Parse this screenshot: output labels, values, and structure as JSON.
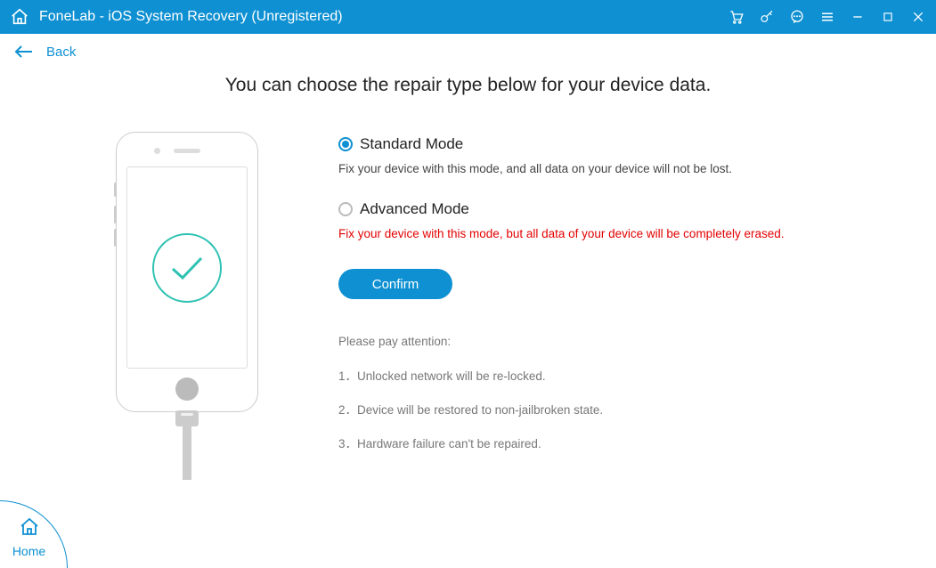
{
  "titlebar": {
    "title": "FoneLab - iOS System Recovery (Unregistered)"
  },
  "back": {
    "label": "Back"
  },
  "heading": "You can choose the repair type below for your device data.",
  "modes": {
    "standard": {
      "title": "Standard Mode",
      "desc": "Fix your device with this mode, and all data on your device will not be lost."
    },
    "advanced": {
      "title": "Advanced Mode",
      "desc": "Fix your device with this mode, but all data of your device will be completely erased."
    }
  },
  "buttons": {
    "confirm": "Confirm"
  },
  "attention": {
    "title": "Please pay attention:",
    "items": [
      "1．Unlocked network will be re-locked.",
      "2．Device will be restored to non-jailbroken state.",
      "3．Hardware failure can't be repaired."
    ]
  },
  "home": {
    "label": "Home"
  },
  "colors": {
    "primary": "#0e90d2",
    "teal": "#2ec2b3",
    "danger": "#e30000"
  }
}
